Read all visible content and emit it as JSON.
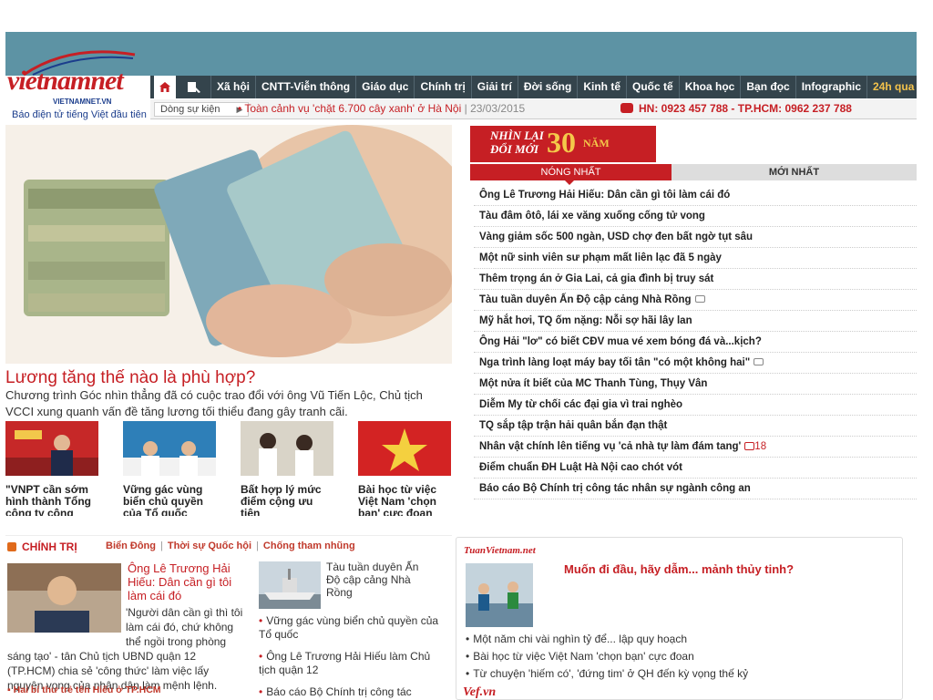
{
  "brand": {
    "logo_text": "vietnamnet",
    "domain": "VIETNAMNET.VN",
    "tagline": "Báo điện tử tiếng Việt đầu tiên"
  },
  "nav": {
    "items": [
      "Xã hội",
      "CNTT-Viễn thông",
      "Giáo dục",
      "Chính trị",
      "Giải trí",
      "Đời sống",
      "Kinh tế",
      "Quốc tế",
      "Khoa học",
      "Bạn đọc",
      "Infographic"
    ],
    "accent_item": "24h qua"
  },
  "subbar": {
    "label": "Dòng sự kiện",
    "ticker_text": "Toàn cảnh vụ 'chặt 6.700 cây xanh' ở Hà Nội",
    "ticker_date": "23/03/2015",
    "phone": "HN: 0923 457 788 - TP.HCM: 0962 237 788"
  },
  "hero": {
    "title": "Lương tăng thế nào là phù hợp?",
    "description": "Chương trình Góc nhìn thẳng đã có cuộc trao đổi với ông Vũ Tiến Lộc, Chủ tịch VCCI xung quanh vấn đề tăng lương tối thiểu đang gây tranh cãi."
  },
  "thumbs": [
    {
      "caption": "\"VNPT cần sớm hình thành Tổng công ty công"
    },
    {
      "caption": "Vững gác vùng biển chủ quyền của Tổ quốc"
    },
    {
      "caption": "Bất hợp lý mức điểm cộng ưu tiên"
    },
    {
      "caption": "Bài học từ việc Việt Nam 'chọn bạn' cực đoan"
    }
  ],
  "banner": {
    "line1": "NHÌN LẠI",
    "line2": "ĐỔI MỚI",
    "number": "30",
    "unit": "NĂM"
  },
  "tabs": {
    "hot": "NÓNG NHẤT",
    "new": "MỚI NHẤT"
  },
  "hot_list": [
    {
      "title": "Ông Lê Trương Hải Hiếu: Dân cần gì tôi làm cái đó"
    },
    {
      "title": "Tàu đâm ôtô, lái xe văng xuống cống tử vong"
    },
    {
      "title": "Vàng giảm sốc 500 ngàn, USD chợ đen bất ngờ tụt sâu"
    },
    {
      "title": "Một nữ sinh viên sư phạm mất liên lạc đã 5 ngày"
    },
    {
      "title": "Thêm trọng án ở Gia Lai, cả gia đình bị truy sát"
    },
    {
      "title": "Tàu tuần duyên Ấn Độ cập cảng Nhà Rồng"
    },
    {
      "title": "Mỹ hắt hơi, TQ ốm nặng: Nỗi sợ hãi lây lan"
    },
    {
      "title": "Ông Hải \"lơ\" có biết CĐV mua vé xem bóng đá và...kịch?"
    },
    {
      "title": "Nga trình làng loạt máy bay tối tân \"có một không hai\""
    },
    {
      "title": "Một nửa ít biết của MC Thanh Tùng, Thụy Vân"
    },
    {
      "title": "Diễm My từ chối các đại gia vì trai nghèo"
    },
    {
      "title": "TQ sắp tập trận hải quân bắn đạn thật"
    },
    {
      "title": "Nhân vật chính lên tiếng vụ 'cả nhà tự làm đám tang'",
      "comments": "18"
    },
    {
      "title": "Điểm chuẩn ĐH Luật Hà Nội cao chót vót"
    },
    {
      "title": "Báo cáo Bộ Chính trị công tác nhân sự ngành công an"
    }
  ],
  "section": {
    "heading": "CHÍNH TRỊ",
    "links": [
      "Biển Đông",
      "Thời sự Quốc hội",
      "Chống tham nhũng"
    ],
    "main_title": "Ông Lê Trương Hải Hiếu: Dân cần gì tôi làm cái đó",
    "main_desc": "'Người dân cần gì thì tôi làm cái đó, chứ không thể ngồi trong phòng sáng tạo' - tân Chủ tịch UBND quận 12 (TP.HCM) chia sẻ 'công thức' làm việc lấy nguyện vọng của nhân dân làm mệnh lệnh.",
    "related": "Hai bí thư trẻ tên Hiếu ở TP.HCM",
    "side_title": "Tàu tuần duyên Ấn Độ cập cảng Nhà Rồng",
    "side_list": [
      "Vững gác vùng biển chủ quyền của Tổ quốc",
      "Ông Lê Trương Hải Hiếu làm Chủ tịch quận 12",
      "Báo cáo Bộ Chính trị công tác"
    ]
  },
  "tuanvietnam": {
    "logo": "TuanVietnam.net",
    "title": "Muốn đi đầu, hãy dẫm... mảnh thủy tinh?",
    "list": [
      "Một năm chi vài nghìn tỷ để... lập quy hoạch",
      "Bài học từ việc Việt Nam 'chọn bạn' cực đoan",
      "Từ chuyện 'hiếm có', 'đứng tim' ở QH đến kỳ vọng thế kỷ"
    ]
  },
  "vef": {
    "logo": "Vef.vn"
  },
  "colors": {
    "brand_red": "#c61f24",
    "top_band": "#5d93a4",
    "nav_bg": "#34444c",
    "accent_yellow": "#f3c24b"
  }
}
